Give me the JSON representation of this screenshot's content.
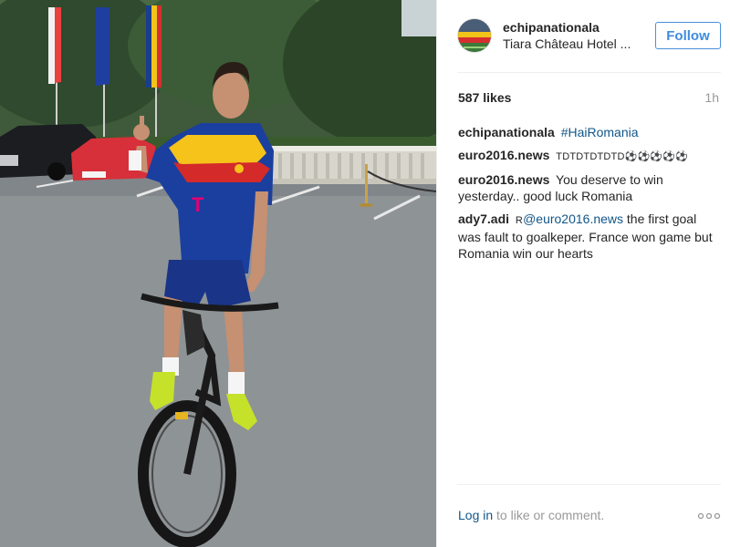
{
  "post": {
    "username": "echipanationala",
    "location": "Tiara Château Hotel ...",
    "follow_label": "Follow",
    "likes": "587 likes",
    "time_ago": "1h",
    "comments": [
      {
        "author": "echipanationala",
        "text": "",
        "hashtag": "#HaiRomania"
      },
      {
        "author": "euro2016.news",
        "text": "TDTDTDTDTD⚽⚽⚽⚽⚽"
      },
      {
        "author": "euro2016.news",
        "text": "You deserve to win yesterday.. good luck Romania"
      },
      {
        "author": "ady7.adi",
        "prefix": "R",
        "mention": "@euro2016.news",
        "text": " the first goal was fault to goalkeper. France won game but Romania win our hearts"
      }
    ],
    "footer": {
      "login_label": "Log in",
      "suffix": " to like or comment."
    },
    "more_icon": "ellipsis-icon"
  },
  "colors": {
    "accent": "#3f8ce0",
    "link": "#125688",
    "muted": "#999999"
  }
}
